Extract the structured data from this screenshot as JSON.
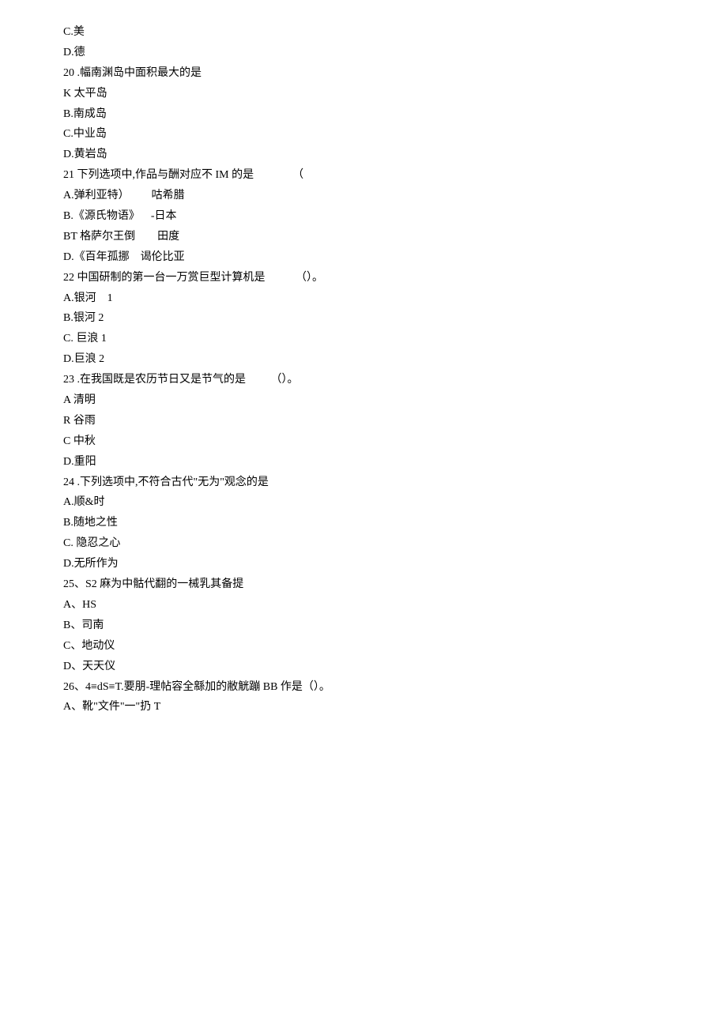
{
  "lines": [
    "C.美",
    "D.德",
    "20 .幅南渊岛中面积最大的是",
    "K 太平岛",
    "B.南成岛",
    "C.中业岛",
    "D.黄岩岛",
    "21 下列选项中,作品与酬对应不 IM 的是              （",
    "A.弹利亚特）        咕希腊",
    "B.《源氏物语》    -日本",
    "BT 格萨尔王倒        田度",
    "D.《百年孤挪    谒伦比亚",
    "22 中国研制的第一台一万赏巨型计算机是           （）。",
    "A.银河    1",
    "B.银河 2",
    "C. 巨浪 1",
    "D.巨浪 2",
    "23 .在我国既是农历节日又是节气的是         （）。",
    "A 清明",
    "R 谷雨",
    "C 中秋",
    "D.重阳",
    "24 .下列选项中,不符合古代\"无为\"观念的是",
    "A.顺&时",
    "B.随地之性",
    "C. 隐忍之心",
    "D.无所作为",
    "25、S2 麻为中骷代翻的一械乳其备提",
    "A、HS",
    "B、司南",
    "C、地动仪",
    "D、天天仪",
    "26、4≡dS≡T.要朋-理帖容全緜加的敝觥蹦 BB 作是（）。",
    "A、靴\"文件\"一\"扔 T"
  ]
}
